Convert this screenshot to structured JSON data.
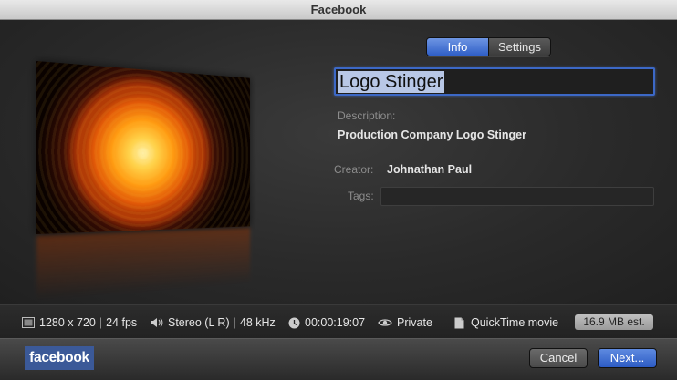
{
  "window": {
    "title": "Facebook"
  },
  "tabs": [
    {
      "label": "Info",
      "active": true
    },
    {
      "label": "Settings",
      "active": false
    }
  ],
  "info": {
    "title_value": "Logo Stinger",
    "description_label": "Description:",
    "description_value": "Production Company Logo Stinger",
    "creator_label": "Creator:",
    "creator_value": "Johnathan Paul",
    "tags_label": "Tags:",
    "tags_value": ""
  },
  "status": {
    "resolution": "1280 x 720",
    "fps": "24 fps",
    "audio": "Stereo (L R)",
    "sample_rate": "48 kHz",
    "duration": "00:00:19:07",
    "privacy": "Private",
    "format": "QuickTime movie",
    "size": "16.9 MB est."
  },
  "footer": {
    "logo_text": "facebook",
    "cancel_label": "Cancel",
    "next_label": "Next..."
  },
  "icons": {
    "resolution": "frame-icon",
    "audio": "speaker-icon",
    "duration": "clock-icon",
    "privacy": "eye-icon",
    "format": "document-icon"
  },
  "colors": {
    "accent": "#3c68c6",
    "facebook": "#3b5998"
  }
}
